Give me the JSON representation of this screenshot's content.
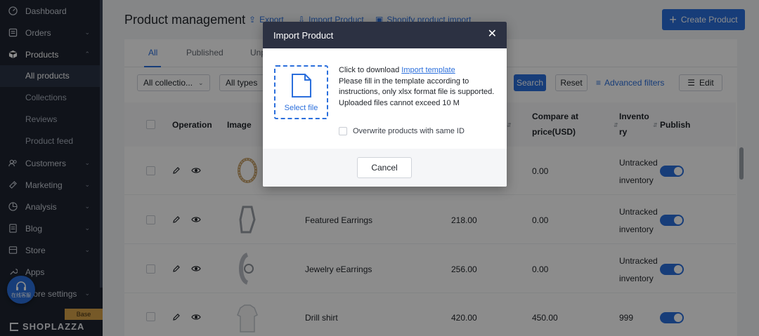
{
  "sidebar": {
    "items": [
      {
        "label": "Dashboard",
        "icon": "dashboard-icon",
        "has_chevron": false
      },
      {
        "label": "Orders",
        "icon": "orders-icon",
        "has_chevron": true
      },
      {
        "label": "Products",
        "icon": "products-icon",
        "has_chevron": true,
        "expanded": true
      },
      {
        "label": "Customers",
        "icon": "customers-icon",
        "has_chevron": true
      },
      {
        "label": "Marketing",
        "icon": "marketing-icon",
        "has_chevron": true
      },
      {
        "label": "Analysis",
        "icon": "analysis-icon",
        "has_chevron": true
      },
      {
        "label": "Blog",
        "icon": "blog-icon",
        "has_chevron": true
      },
      {
        "label": "Store",
        "icon": "store-icon",
        "has_chevron": true
      },
      {
        "label": "Apps",
        "icon": "apps-icon",
        "has_chevron": false
      },
      {
        "label": "Store settings",
        "icon": "settings-icon",
        "has_chevron": true
      }
    ],
    "products_sub": [
      "All products",
      "Collections",
      "Reviews",
      "Product feed"
    ],
    "support_label": "在线客服",
    "plan_badge": "Base",
    "brand": "SHOPLAZZA"
  },
  "header": {
    "title": "Product management",
    "export_label": "Export",
    "import_label": "Import Product",
    "shopify_label": "Shopify product import",
    "create_label": "Create Product"
  },
  "tabs": [
    "All",
    "Published",
    "Unp"
  ],
  "filters": {
    "collection": "All collectio...",
    "types": "All types",
    "search": "Search",
    "reset": "Reset",
    "advanced": "Advanced filters",
    "edit": "Edit"
  },
  "table": {
    "headers": {
      "operation": "Operation",
      "image": "Image",
      "compare_1": "Compare at",
      "compare_2": "price(USD)",
      "inventory_1": "Invento",
      "inventory_2": "ry",
      "publish": "Publish"
    },
    "rows": [
      {
        "name": "",
        "price": "",
        "compare": "0.00",
        "inv_1": "Untracked",
        "inv_2": "inventory",
        "published": true
      },
      {
        "name": "Featured Earrings",
        "price": "218.00",
        "compare": "0.00",
        "inv_1": "Untracked",
        "inv_2": "inventory",
        "published": true
      },
      {
        "name": "Jewelry eEarrings",
        "price": "256.00",
        "compare": "0.00",
        "inv_1": "Untracked",
        "inv_2": "inventory",
        "published": true
      },
      {
        "name": "Drill shirt",
        "price": "420.00",
        "compare": "450.00",
        "inv_1": "999",
        "inv_2": "",
        "published": true
      }
    ]
  },
  "modal": {
    "title": "Import Product",
    "select_file": "Select file",
    "download_prefix": "Click to download ",
    "download_link": "Import template",
    "line_2": "Please fill in the template according to instructions, only xlsx format file is supported.",
    "line_3": "Uploaded files cannot exceed 10 M",
    "overwrite_label": "Overwrite products with same ID",
    "cancel_label": "Cancel"
  },
  "colors": {
    "accent": "#2b6fdc",
    "sidebar_bg": "#1e2430",
    "modal_header": "#2c3142"
  }
}
